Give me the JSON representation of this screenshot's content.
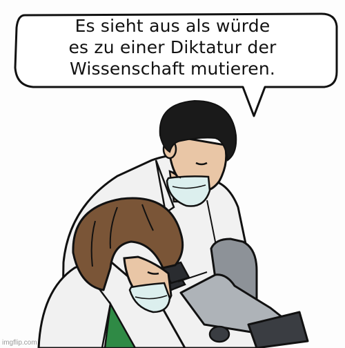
{
  "speech_bubble": {
    "lines": [
      "Es sieht aus als würde",
      "es zu einer Diktatur der",
      "Wissenschaft mutieren."
    ]
  },
  "watermark": {
    "text": "imgflip.com"
  },
  "figures": [
    "male-scientist",
    "female-scientist",
    "microscope"
  ],
  "colors": {
    "outline": "#111111",
    "bubble_fill": "#ffffff",
    "lab_coat": "#f1f1f1",
    "coat_shadow": "#d9d9d9",
    "skin": "#e9c6a6",
    "male_hair": "#1a1a1a",
    "female_hair": "#7a5537",
    "mask": "#dcefee",
    "shirt_green": "#2f8a45",
    "microscope_gray": "#8d9298",
    "microscope_dark": "#3a3d42"
  }
}
